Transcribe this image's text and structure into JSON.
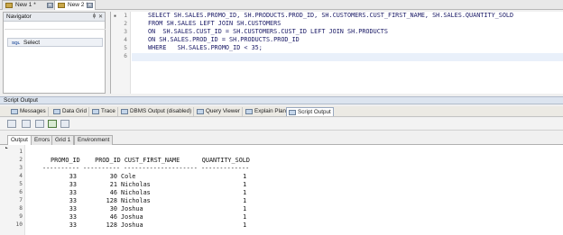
{
  "doc_tabs": [
    {
      "label": "New 1 *",
      "close": "✕"
    },
    {
      "label": "New 2 *",
      "close": "✕"
    }
  ],
  "navigator": {
    "title": "Navigator",
    "pin": "ɸ",
    "close": "✕",
    "combo_icon": "SQL",
    "combo_label": "Select"
  },
  "editor": {
    "line_numbers": [
      "1",
      "2",
      "3",
      "4",
      "5",
      "6"
    ],
    "lines": [
      "SELECT SH.SALES.PROMO_ID, SH.PRODUCTS.PROD_ID, SH.CUSTOMERS.CUST_FIRST_NAME, SH.SALES.QUANTITY_SOLD",
      "FROM SH.SALES LEFT JOIN SH.CUSTOMERS",
      "ON  SH.SALES.CUST_ID = SH.CUSTOMERS.CUST_ID LEFT JOIN SH.PRODUCTS",
      "ON SH.SALES.PROD_ID = SH.PRODUCTS.PROD_ID",
      "WHERE   SH.SALES.PROMO_ID < 35;",
      ""
    ]
  },
  "script_output": {
    "title": "Script Output",
    "tabs": [
      "Messages",
      "Data Grid",
      "Trace",
      "DBMS Output (disabled)",
      "Query Viewer",
      "Explain Plan",
      "Script Output"
    ],
    "result_tabs": [
      "Output",
      "Errors",
      "Grid 1",
      "Environment"
    ],
    "line_numbers": [
      "1",
      "2",
      "3",
      "4",
      "5",
      "6",
      "7",
      "8",
      "9",
      "10"
    ],
    "header": "PROMO_ID    PROD_ID CUST_FIRST_NAME      QUANTITY_SOLD",
    "separator": "---------- ---------- -------------------- -------------",
    "rows": [
      "        33         30 Cole                             1",
      "        33         21 Nicholas                         1",
      "        33         46 Nicholas                         1",
      "        33        128 Nicholas                         1",
      "        33         30 Joshua                           1",
      "        33         46 Joshua                           1",
      "        33        128 Joshua                           1"
    ]
  },
  "colors": {
    "highlight": "#e9f0fa",
    "panel_header": "#dce4ef",
    "keyword": "#1b1b9a"
  }
}
